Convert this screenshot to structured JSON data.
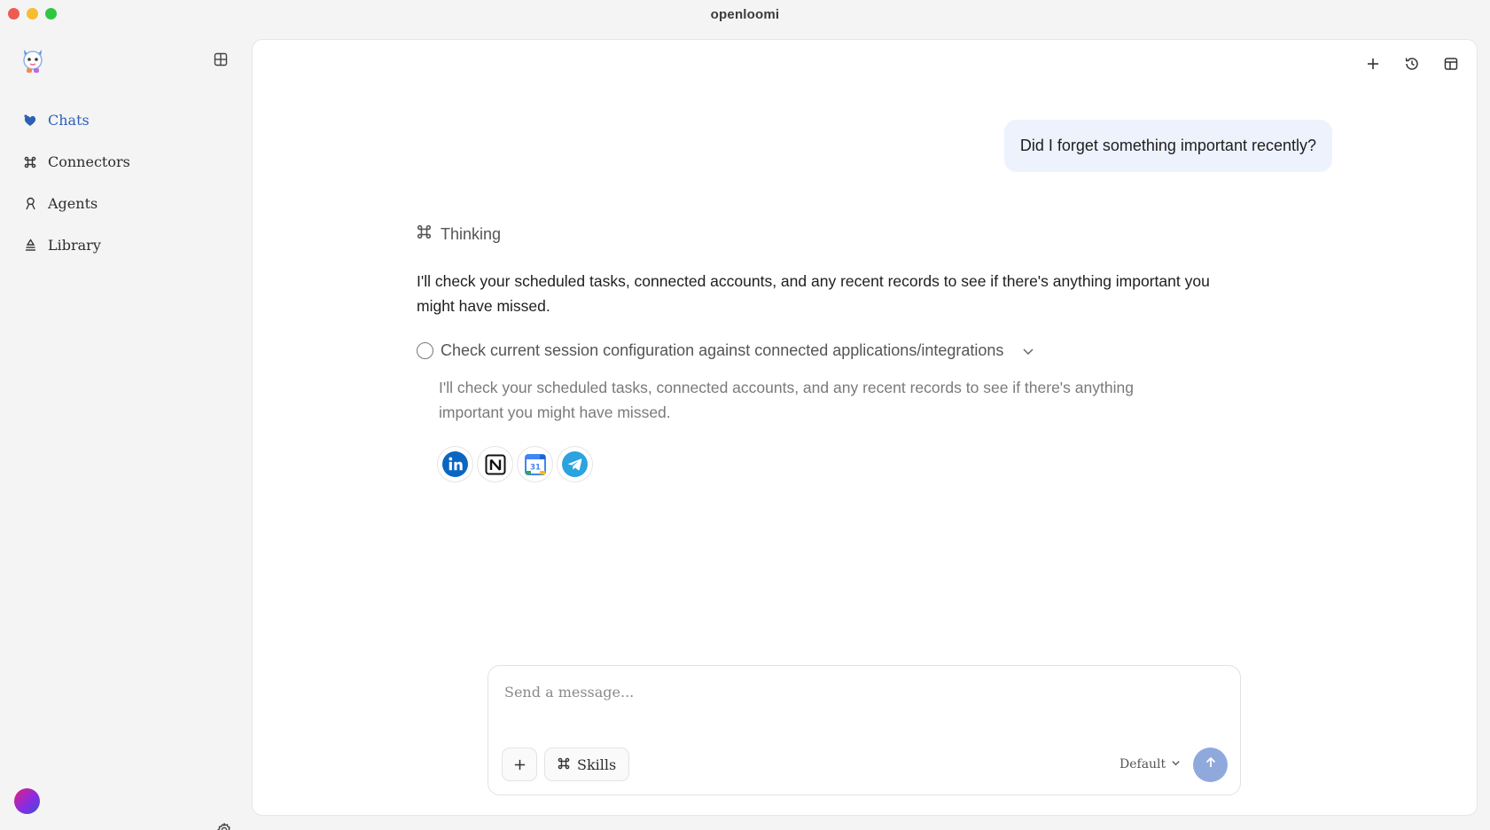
{
  "window": {
    "title": "openloomi"
  },
  "sidebar": {
    "items": [
      {
        "label": "Chats",
        "icon": "heart-bubble-icon",
        "active": true
      },
      {
        "label": "Connectors",
        "icon": "command-icon",
        "active": false
      },
      {
        "label": "Agents",
        "icon": "agent-icon",
        "active": false
      },
      {
        "label": "Library",
        "icon": "library-icon",
        "active": false
      }
    ]
  },
  "conversation": {
    "user_message": "Did I forget something important recently?",
    "thinking_label": "Thinking",
    "assistant_message": "I'll check your scheduled tasks, connected accounts, and any recent records to see if there's anything important you might have missed.",
    "task": {
      "title": "Check current session configuration against connected applications/integrations",
      "description": "I'll check your scheduled tasks, connected accounts, and any recent records to see if there's anything important you might have missed.",
      "apps": [
        "linkedin-icon",
        "notion-icon",
        "google-calendar-icon",
        "telegram-icon"
      ]
    }
  },
  "composer": {
    "placeholder": "Send a message...",
    "skills_label": "Skills",
    "model_label": "Default"
  },
  "colors": {
    "accent": "#2d5fb5",
    "user_bubble": "#edf2fd",
    "send_button": "#90a9dd"
  }
}
